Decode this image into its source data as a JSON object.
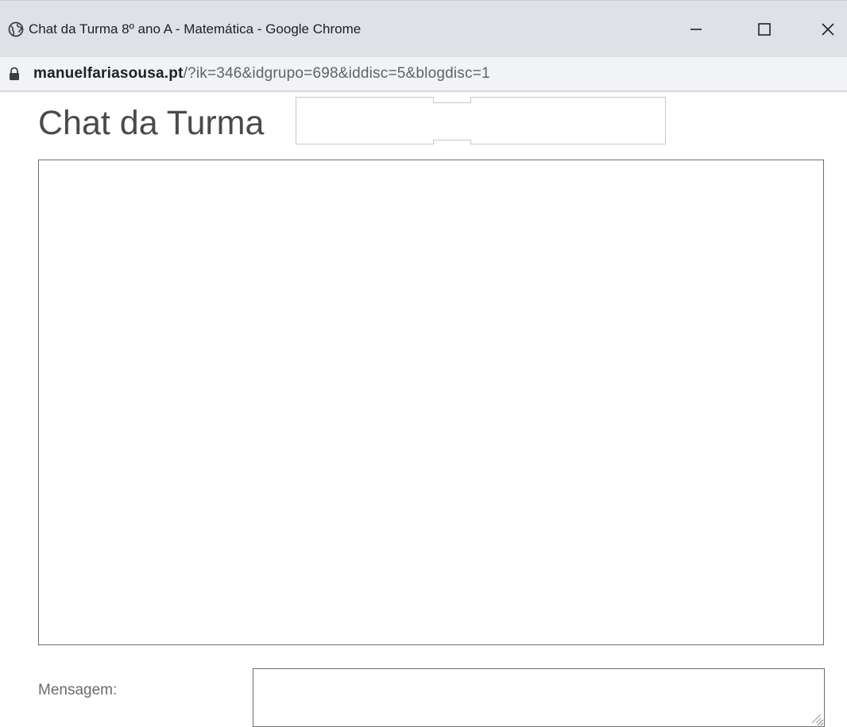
{
  "window": {
    "title": "Chat da Turma 8º ano A - Matemática - Google Chrome",
    "icons": {
      "site": "globe-icon",
      "minimize": "minimize-icon",
      "maximize": "maximize-icon",
      "close": "close-icon"
    }
  },
  "address_bar": {
    "lock_icon": "lock-icon",
    "domain": "manuelfariasousa.pt",
    "path": "/?ik=346&idgrupo=698&iddisc=5&blogdisc=1"
  },
  "page": {
    "title": "Chat da Turma "
  },
  "chat": {
    "messages": []
  },
  "message_form": {
    "label": "Mensagem:",
    "value": "",
    "placeholder": ""
  },
  "colors": {
    "titlebar_bg": "#dee1e6",
    "addressbar_bg": "#f1f3f4",
    "border": "#6f6f6f",
    "title_text": "#4a4a4a"
  }
}
